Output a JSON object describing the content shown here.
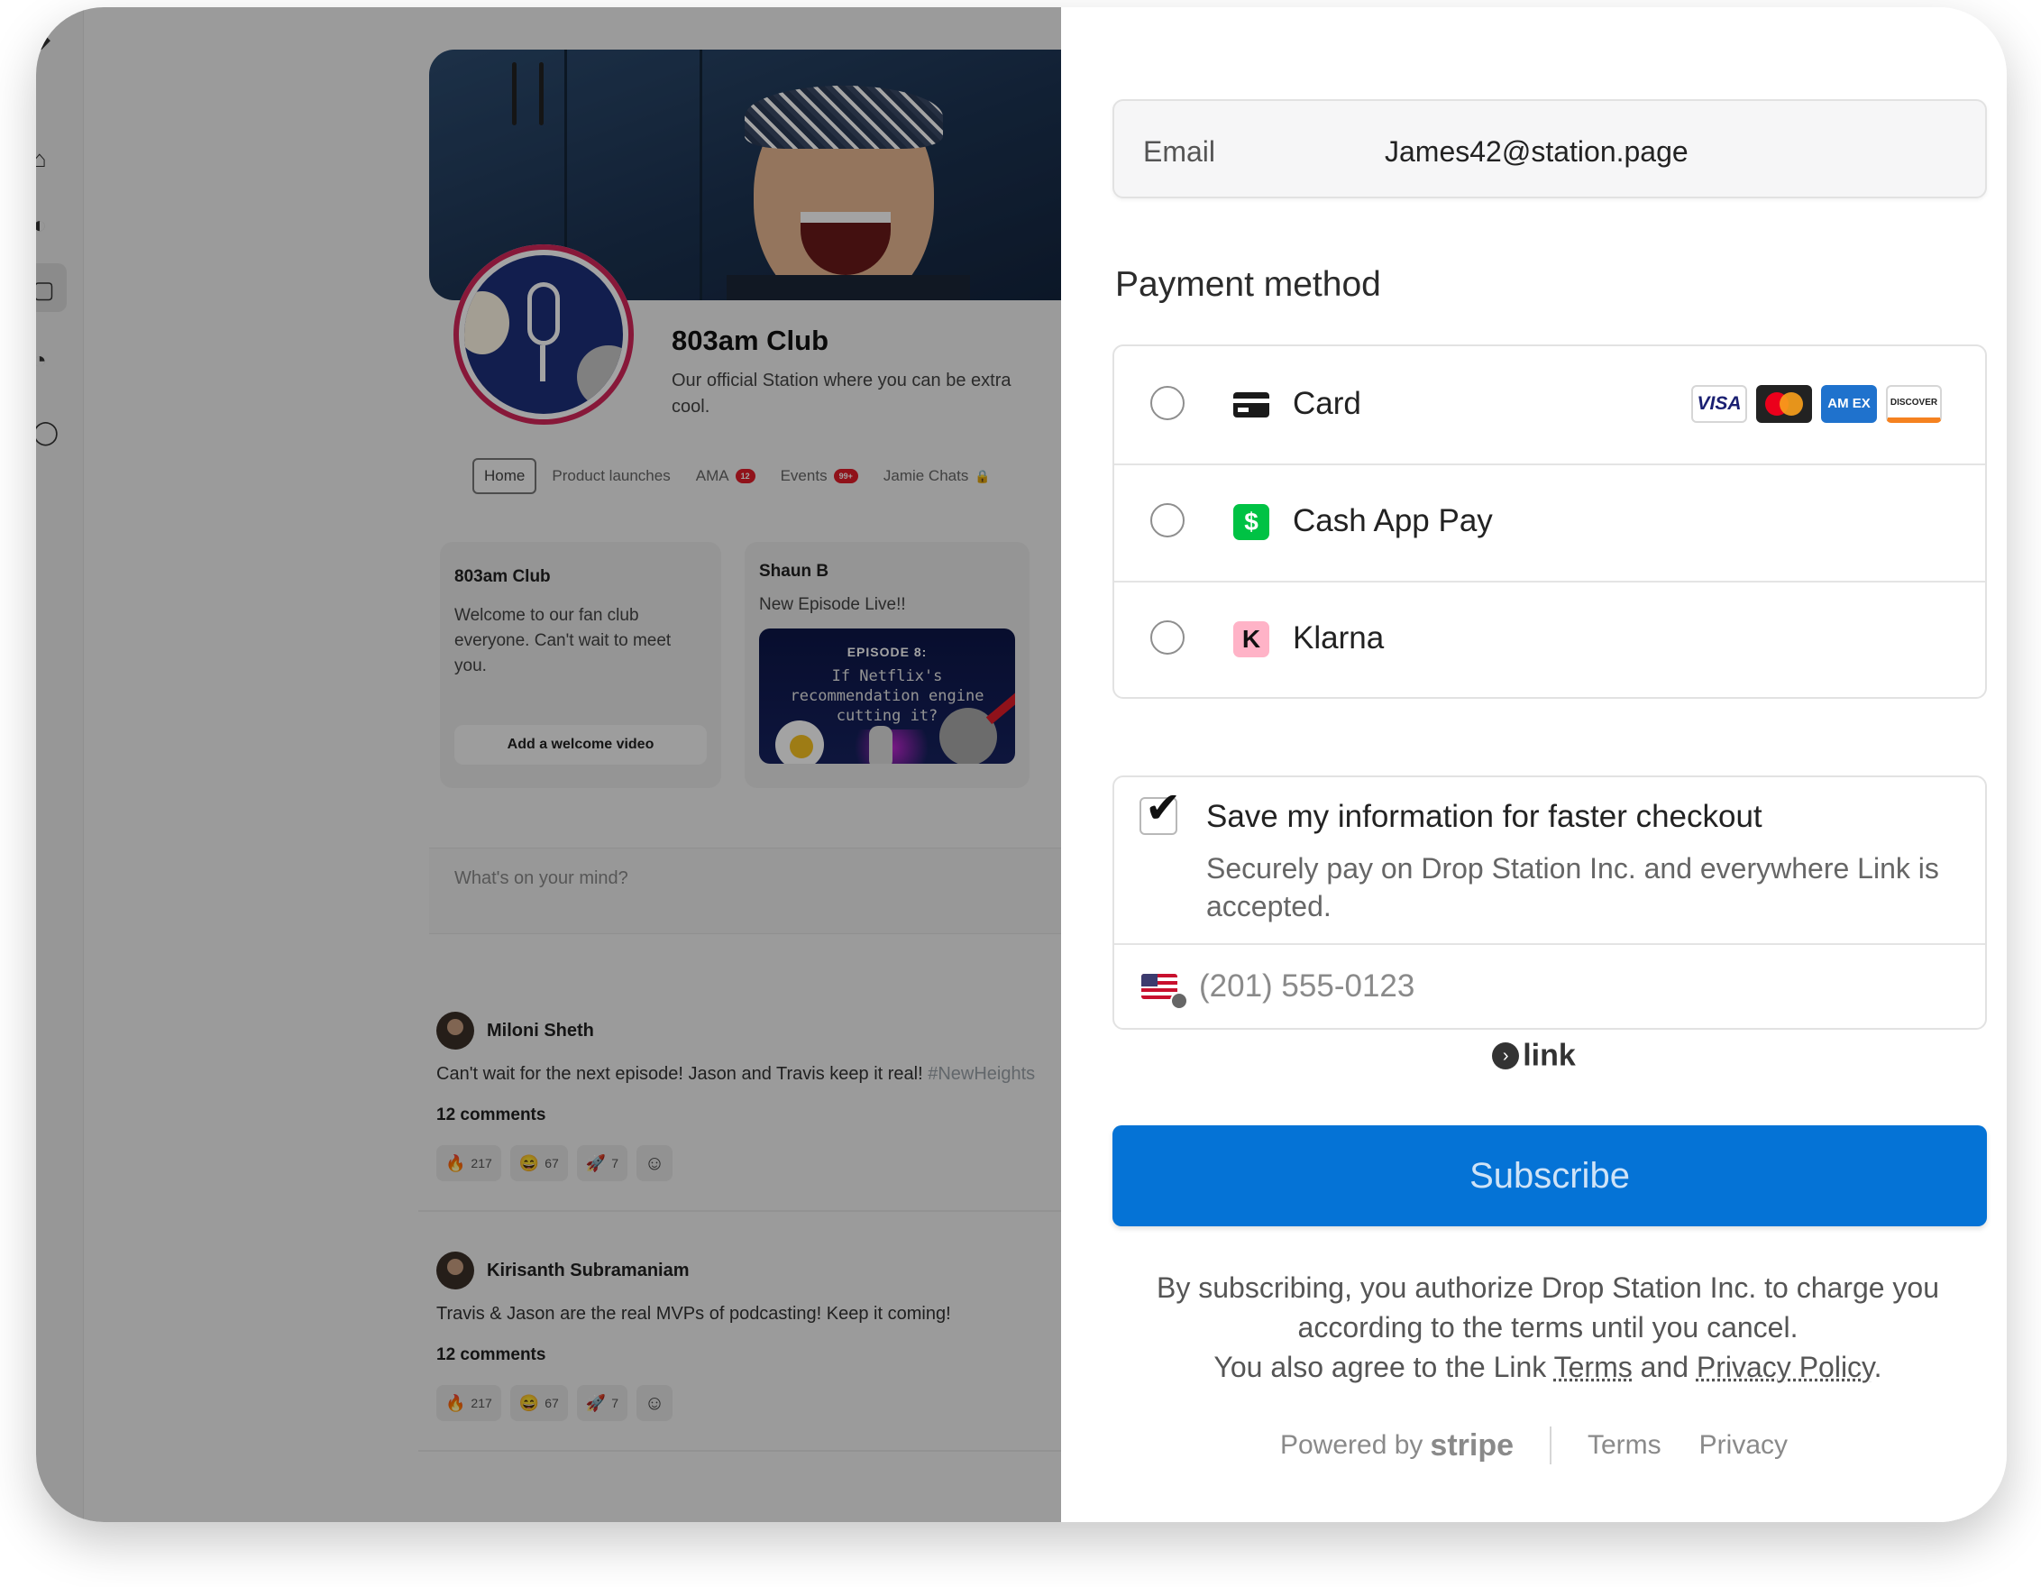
{
  "community": {
    "name": "803am Club",
    "description": "Our official Station where you can be extra cool.",
    "tabs": [
      {
        "label": "Home"
      },
      {
        "label": "Product launches"
      },
      {
        "label": "AMA",
        "badge": "12"
      },
      {
        "label": "Events",
        "badge": "99+"
      },
      {
        "label": "Jamie Chats"
      }
    ],
    "welcome_card": {
      "title": "803am Club",
      "text": "Welcome to our fan club everyone. Can't wait to meet you.",
      "button": "Add a welcome video"
    },
    "episode_card": {
      "author": "Shaun B",
      "text": "New Episode Live!!",
      "image_label": "EPISODE 8:",
      "image_title": "If Netflix's recommendation engine cutting it?"
    },
    "composer_placeholder": "What's on your mind?",
    "posts": [
      {
        "author": "Miloni Sheth",
        "text": "Can't wait for the next episode! Jason and Travis keep it real! ",
        "hashtag": "#NewHeights",
        "comments": "12 comments",
        "reactions": [
          {
            "emoji": "🔥",
            "count": "217"
          },
          {
            "emoji": "😄",
            "count": "67"
          },
          {
            "emoji": "🚀",
            "count": "7"
          }
        ]
      },
      {
        "author": "Kirisanth Subramaniam",
        "text": "Travis & Jason are the real MVPs of podcasting! Keep it coming!",
        "hashtag": "",
        "comments": "12 comments",
        "reactions": [
          {
            "emoji": "🔥",
            "count": "217"
          },
          {
            "emoji": "😄",
            "count": "67"
          },
          {
            "emoji": "🚀",
            "count": "7"
          }
        ]
      }
    ]
  },
  "checkout": {
    "email_label": "Email",
    "email_value": "James42@station.page",
    "payment_method_title": "Payment method",
    "methods": [
      {
        "label": "Card",
        "icon": "credit-card-icon",
        "selected": false
      },
      {
        "label": "Cash App Pay",
        "icon": "cash-app-icon",
        "icon_glyph": "$",
        "selected": false
      },
      {
        "label": "Klarna",
        "icon": "klarna-icon",
        "icon_glyph": "K",
        "selected": false
      }
    ],
    "card_brands": [
      "VISA",
      "mastercard",
      "AM EX",
      "DISCOVER"
    ],
    "save_info": {
      "checked": true,
      "title": "Save my information for faster checkout",
      "description": "Securely pay on Drop Station Inc. and everywhere Link is accepted.",
      "phone_placeholder": "(201) 555-0123"
    },
    "link_label": "link",
    "subscribe_label": "Subscribe",
    "legal": {
      "line1": "By subscribing, you authorize Drop Station Inc. to charge you according to the terms until you cancel.",
      "line2_prefix": "You also agree to the Link ",
      "terms_link": "Terms",
      "and": " and ",
      "privacy_link": "Privacy Policy",
      "suffix": "."
    },
    "footer": {
      "powered_by": "Powered by",
      "brand": "stripe",
      "terms": "Terms",
      "privacy": "Privacy"
    },
    "colors": {
      "primary": "#0573d6",
      "cash_app": "#00c244",
      "klarna": "#ffb3c7"
    }
  }
}
